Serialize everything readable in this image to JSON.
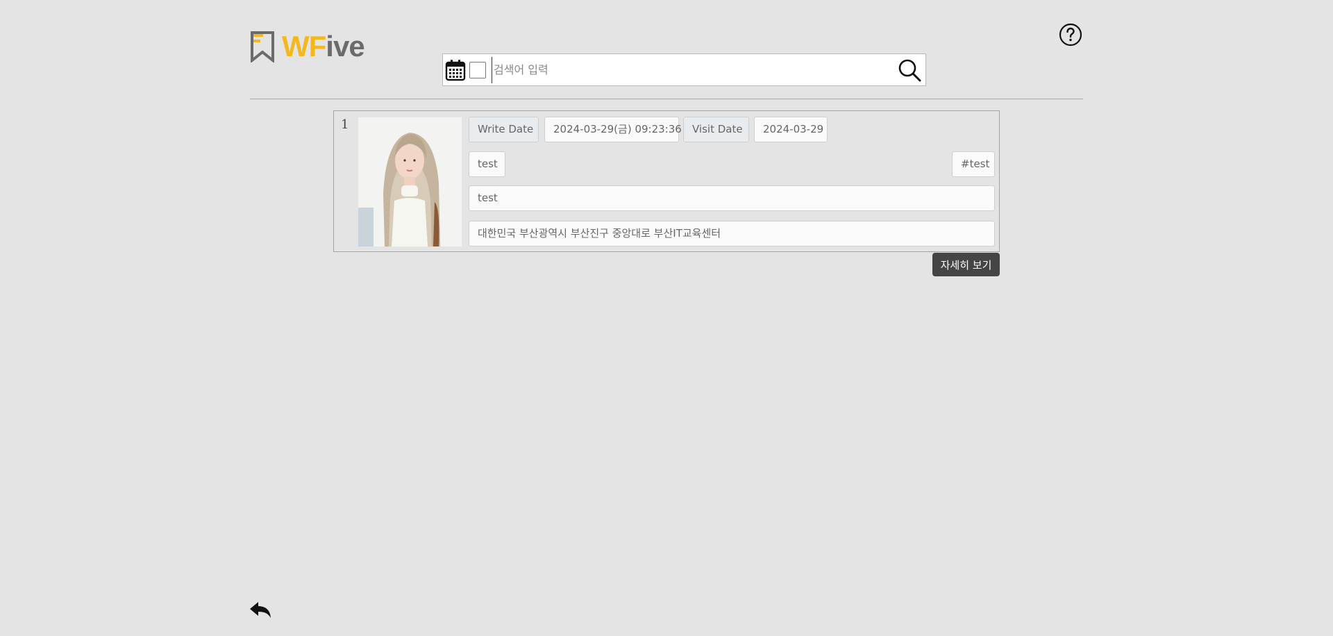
{
  "header": {
    "logo_accent": "WF",
    "logo_rest": "ive",
    "brand_color": "#f5b81c",
    "logo_gray": "#6b6b6b",
    "help_icon": "question-circle-icon"
  },
  "search": {
    "placeholder": "검색어 입력",
    "value": "",
    "calendar_icon": "calendar-icon",
    "search_icon": "magnifier-icon"
  },
  "results": [
    {
      "index": "1",
      "write_date_label": "Write Date",
      "write_date": "2024-03-29(금) 09:23:36",
      "visit_date_label": "Visit Date",
      "visit_date": "2024-03-29",
      "title": "test",
      "tag": "#test",
      "content": "test",
      "address": "대한민국 부산광역시 부산진구 중앙대로 부산IT교육센터",
      "detail_button": "자세히 보기"
    }
  ],
  "footer": {
    "back_icon": "reply-arrow-icon"
  }
}
